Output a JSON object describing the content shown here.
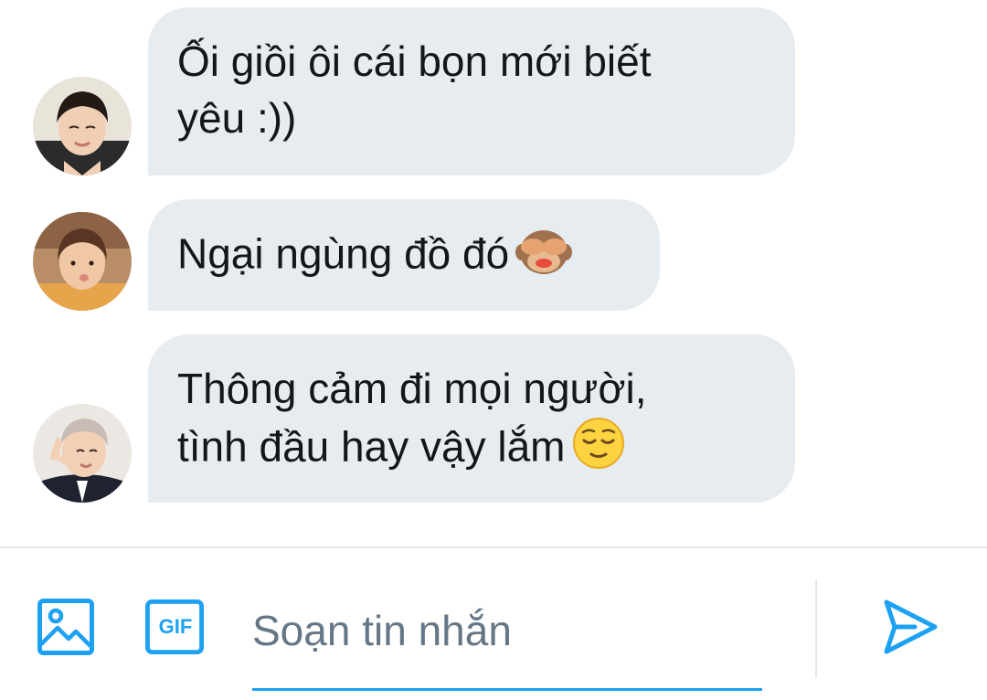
{
  "messages": [
    {
      "lines": [
        "Ối giồi ôi cái bọn mới biết",
        "yêu :))"
      ],
      "avatar": "avatar-man-dark-hair"
    },
    {
      "lines": [
        "Ngại ngùng đồ đó"
      ],
      "emoji": "see-no-evil-monkey-icon",
      "avatar": "avatar-man-brown-hair"
    },
    {
      "lines": [
        "Thông cảm đi mọi người,",
        "tình đầu hay vậy lắm"
      ],
      "emoji": "relieved-face-icon",
      "avatar": "avatar-man-silver-hair"
    }
  ],
  "composer": {
    "image_button": "image-icon",
    "gif_label": "GIF",
    "placeholder": "Soạn tin nhắn",
    "send_button": "send-icon"
  },
  "colors": {
    "accent": "#1da1f2",
    "bubble": "#e6ecf0",
    "text": "#14171a",
    "placeholder": "#657786",
    "divider": "#e1e8ed"
  }
}
